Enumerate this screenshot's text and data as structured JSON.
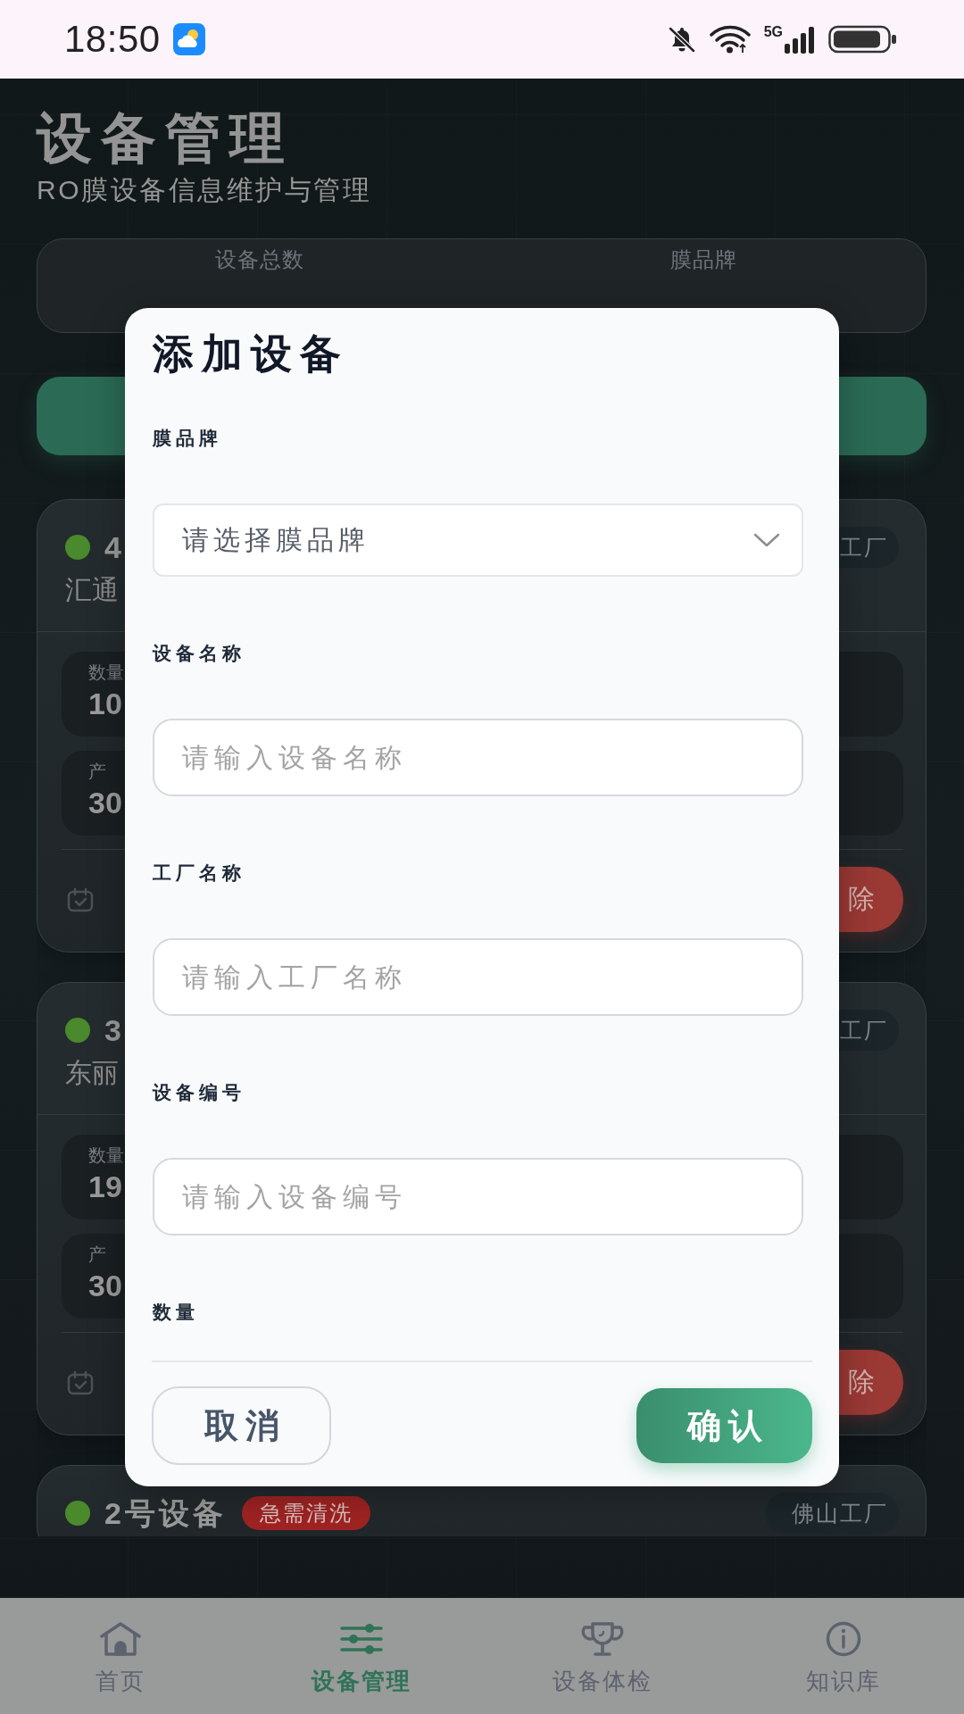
{
  "status_bar": {
    "time": "18:50",
    "network": "5G"
  },
  "header": {
    "title": "设备管理",
    "subtitle": "RO膜设备信息维护与管理"
  },
  "stats": [
    {
      "label": "设备总数"
    },
    {
      "label": "膜品牌"
    }
  ],
  "devices": [
    {
      "name": "4",
      "color": "#4a8a2c",
      "subtitle": "汇通",
      "factory": "工厂",
      "metrics": [
        {
          "label": "数量",
          "value": "10"
        },
        {
          "label": "产",
          "value": "30"
        }
      ],
      "delete_label": "除"
    },
    {
      "name": "3",
      "color": "#4a8a2c",
      "subtitle": "东丽",
      "factory": "工厂",
      "metrics": [
        {
          "label": "数量",
          "value": "19"
        },
        {
          "label": "产",
          "value": "30"
        }
      ],
      "delete_label": "除"
    },
    {
      "name": "2号设备",
      "color": "#4a8a2c",
      "badge": "急需清洗",
      "factory": "佛山工厂"
    }
  ],
  "dialog": {
    "title": "添加设备",
    "fields": [
      {
        "kind": "select",
        "label": "膜品牌",
        "placeholder": "请选择膜品牌"
      },
      {
        "kind": "input",
        "label": "设备名称",
        "placeholder": "请输入设备名称"
      },
      {
        "kind": "input",
        "label": "工厂名称",
        "placeholder": "请输入工厂名称"
      },
      {
        "kind": "input",
        "label": "设备编号",
        "placeholder": "请输入设备编号"
      },
      {
        "kind": "label",
        "label": "数量"
      }
    ],
    "buttons": [
      {
        "kind": "secondary",
        "label": "取消"
      },
      {
        "kind": "primary",
        "label": "确认"
      }
    ]
  },
  "nav": [
    {
      "label": "首页",
      "selected": false
    },
    {
      "label": "设备管理",
      "selected": true
    },
    {
      "label": "设备体检",
      "selected": false
    },
    {
      "label": "知识库",
      "selected": false
    }
  ]
}
